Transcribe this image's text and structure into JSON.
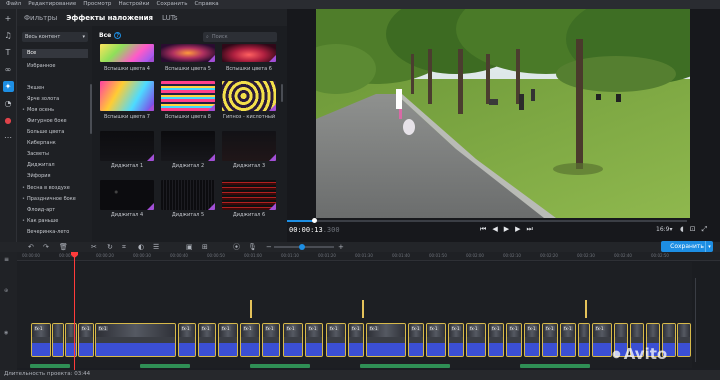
{
  "menu": [
    "Файл",
    "Редактирование",
    "Просмотр",
    "Настройки",
    "Сохранить",
    "Справка"
  ],
  "left_tools": [
    "plus-icon",
    "music-icon",
    "text-icon",
    "transitions-icon",
    "effects-icon",
    "stickers-icon",
    "record-icon",
    "more-icon"
  ],
  "panel": {
    "tabs": [
      "Фильтры",
      "Эффекты наложения",
      "LUTs"
    ],
    "active_tab": 1,
    "category_dropdown": "Весь контент",
    "categories": [
      "Все",
      "Избранное",
      "Экшен",
      "Ярче золота",
      "Моя осень",
      "Фигурное боке",
      "Больше цвета",
      "Киберпанк",
      "Засветы",
      "Диджитал",
      "Эйфория",
      "Весна в воздухе",
      "Праздничное боке",
      "Флоид-арт",
      "Как раньше",
      "Вечеринка-лето"
    ],
    "selected_category": 0,
    "grid_title": "Все",
    "search_placeholder": "Поиск",
    "items": [
      {
        "label": "Вспышки цвета 4"
      },
      {
        "label": "Вспышки цвета 5"
      },
      {
        "label": "Вспышки цвета 6"
      },
      {
        "label": "Вспышки цвета 7"
      },
      {
        "label": "Вспышки цвета 8"
      },
      {
        "label": "Гипноз - кислотный"
      },
      {
        "label": "Диджитал 1"
      },
      {
        "label": "Диджитал 2"
      },
      {
        "label": "Диджитал 3"
      },
      {
        "label": "Диджитал 4"
      },
      {
        "label": "Диджитал 5"
      },
      {
        "label": "Диджитал 6"
      }
    ]
  },
  "player": {
    "timecode_main": "00:00:13",
    "timecode_frac": ".300",
    "aspect": "16:9",
    "aspect_arrow": "▾",
    "transport": [
      "⏮",
      "◀",
      "▶",
      "▶",
      "⏭"
    ],
    "right_icons": [
      "volume-icon",
      "snapshot-icon",
      "fullscreen-icon"
    ]
  },
  "timeline": {
    "export_label": "Сохранить",
    "ruler_ticks": [
      "00:00:00",
      "00:00:10",
      "00:00:20",
      "00:00:30",
      "00:00:40",
      "00:00:50",
      "00:01:00",
      "00:01:10",
      "00:01:20",
      "00:01:30",
      "00:01:40",
      "00:01:50",
      "00:02:00",
      "00:02:10",
      "00:02:20",
      "00:02:30",
      "00:02:40",
      "00:02:50"
    ],
    "fx_label": "fx·1",
    "duration_text": "Длительность проекта: 03:44"
  },
  "watermark": "Avito",
  "colors": {
    "accent": "#1d8ee3",
    "playhead": "#ff3b3b",
    "clip_border": "#d7b94a",
    "audio": "#3b4fd4"
  }
}
